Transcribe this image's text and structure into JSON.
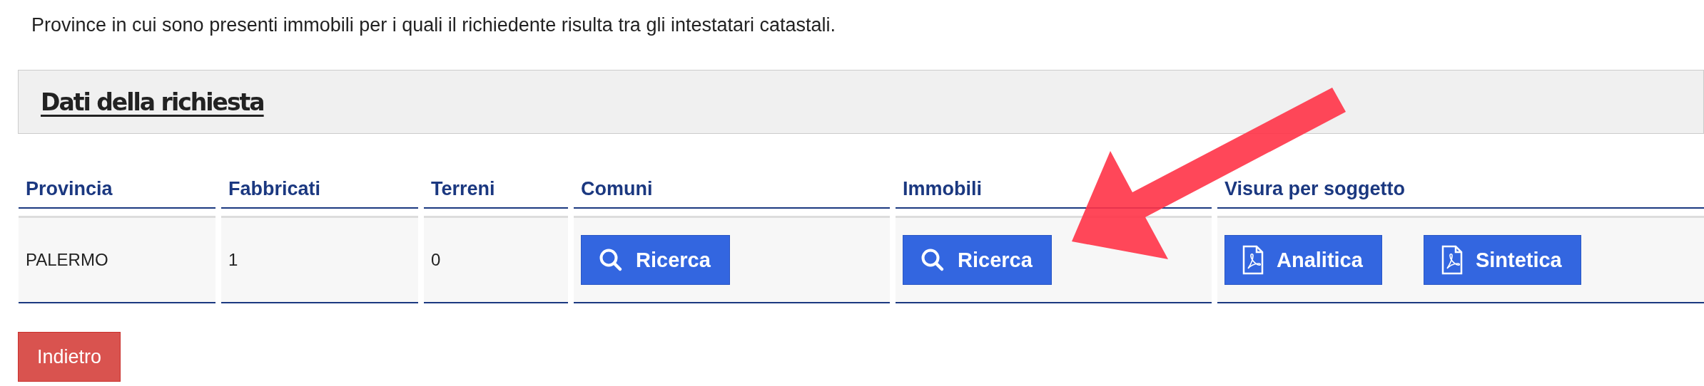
{
  "intro": "Province in cui sono presenti immobili per i quali il richiedente risulta tra gli intestatari catastali.",
  "panel": {
    "title": "Dati della richiesta"
  },
  "table": {
    "columns": [
      "Provincia",
      "Fabbricati",
      "Terreni",
      "Comuni",
      "Immobili",
      "Visura per soggetto"
    ],
    "rows": [
      {
        "cells": [
          {
            "kind": "text",
            "text": "PALERMO"
          },
          {
            "kind": "text",
            "text": "1"
          },
          {
            "kind": "text",
            "text": "0"
          },
          {
            "kind": "buttons",
            "buttons": [
              {
                "kind": "search",
                "label": "Ricerca"
              }
            ]
          },
          {
            "kind": "buttons",
            "buttons": [
              {
                "kind": "search",
                "label": "Ricerca"
              }
            ]
          },
          {
            "kind": "buttons",
            "buttons": [
              {
                "kind": "pdf",
                "label": "Analitica"
              },
              {
                "kind": "pdf",
                "label": "Sintetica"
              }
            ]
          }
        ]
      }
    ]
  },
  "back_button": "Indietro"
}
